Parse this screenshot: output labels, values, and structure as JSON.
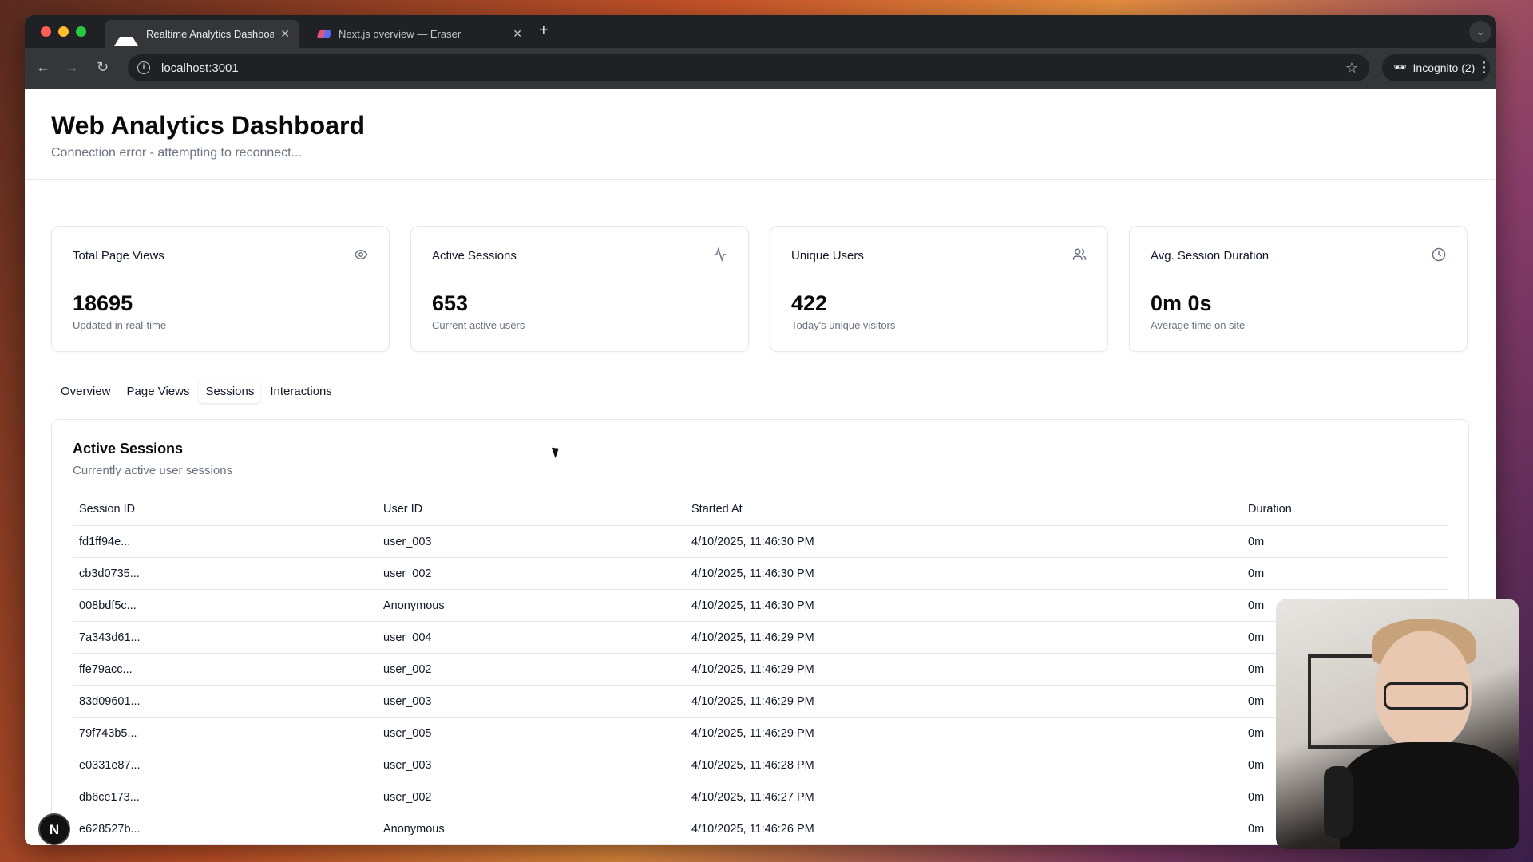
{
  "browser": {
    "tabs": [
      {
        "title": "Realtime Analytics Dashboard",
        "active": true
      },
      {
        "title": "Next.js overview — Eraser",
        "active": false
      }
    ],
    "url": "localhost:3001",
    "incognito_label": "Incognito (2)"
  },
  "header": {
    "title": "Web Analytics Dashboard",
    "subtitle": "Connection error - attempting to reconnect..."
  },
  "cards": [
    {
      "title": "Total Page Views",
      "value": "18695",
      "caption": "Updated in real-time",
      "icon": "eye-icon"
    },
    {
      "title": "Active Sessions",
      "value": "653",
      "caption": "Current active users",
      "icon": "activity-icon"
    },
    {
      "title": "Unique Users",
      "value": "422",
      "caption": "Today's unique visitors",
      "icon": "users-icon"
    },
    {
      "title": "Avg. Session Duration",
      "value": "0m 0s",
      "caption": "Average time on site",
      "icon": "clock-icon"
    }
  ],
  "tabs": [
    "Overview",
    "Page Views",
    "Sessions",
    "Interactions"
  ],
  "selected_tab": "Sessions",
  "panel": {
    "title": "Active Sessions",
    "description": "Currently active user sessions",
    "columns": [
      "Session ID",
      "User ID",
      "Started At",
      "Duration"
    ],
    "rows": [
      [
        "fd1ff94e...",
        "user_003",
        "4/10/2025, 11:46:30 PM",
        "0m"
      ],
      [
        "cb3d0735...",
        "user_002",
        "4/10/2025, 11:46:30 PM",
        "0m"
      ],
      [
        "008bdf5c...",
        "Anonymous",
        "4/10/2025, 11:46:30 PM",
        "0m"
      ],
      [
        "7a343d61...",
        "user_004",
        "4/10/2025, 11:46:29 PM",
        "0m"
      ],
      [
        "ffe79acc...",
        "user_002",
        "4/10/2025, 11:46:29 PM",
        "0m"
      ],
      [
        "83d09601...",
        "user_003",
        "4/10/2025, 11:46:29 PM",
        "0m"
      ],
      [
        "79f743b5...",
        "user_005",
        "4/10/2025, 11:46:29 PM",
        "0m"
      ],
      [
        "e0331e87...",
        "user_003",
        "4/10/2025, 11:46:28 PM",
        "0m"
      ],
      [
        "db6ce173...",
        "user_002",
        "4/10/2025, 11:46:27 PM",
        "0m"
      ],
      [
        "e628527b...",
        "Anonymous",
        "4/10/2025, 11:46:26 PM",
        "0m"
      ]
    ]
  },
  "nextjs_badge": "N"
}
